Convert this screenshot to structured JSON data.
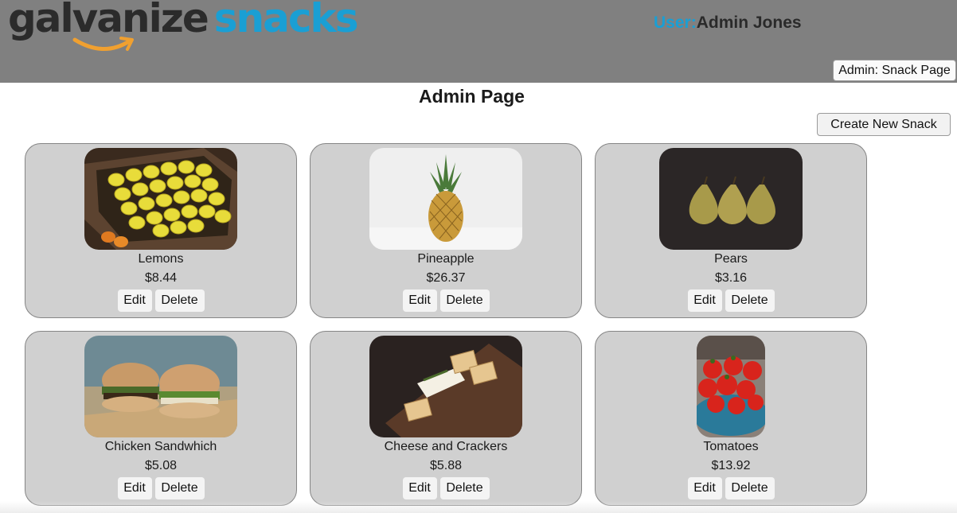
{
  "header": {
    "logo_word1": "galvanize",
    "logo_word2": "snacks",
    "user_prefix": "User:",
    "user_name": "Admin Jones",
    "snack_page_button": "Admin: Snack Page"
  },
  "main": {
    "title": "Admin Page",
    "create_button": "Create New Snack"
  },
  "snacks": [
    {
      "name": "Lemons",
      "price": "$8.44",
      "edit": "Edit",
      "delete": "Delete"
    },
    {
      "name": "Pineapple",
      "price": "$26.37",
      "edit": "Edit",
      "delete": "Delete"
    },
    {
      "name": "Pears",
      "price": "$3.16",
      "edit": "Edit",
      "delete": "Delete"
    },
    {
      "name": "Chicken Sandwhich",
      "price": "$5.08",
      "edit": "Edit",
      "delete": "Delete"
    },
    {
      "name": "Cheese and Crackers",
      "price": "$5.88",
      "edit": "Edit",
      "delete": "Delete"
    },
    {
      "name": "Tomatoes",
      "price": "$13.92",
      "edit": "Edit",
      "delete": "Delete"
    }
  ],
  "colors": {
    "header_bg": "#808080",
    "accent": "#1a9fd4",
    "smile": "#f0a030",
    "card_bg": "#d0d0d0"
  }
}
